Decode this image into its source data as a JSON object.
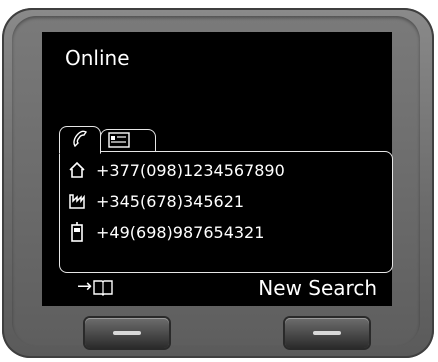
{
  "screen": {
    "title": "Online",
    "tabs": [
      {
        "icon": "phone-handset-icon",
        "selected": true
      },
      {
        "icon": "contact-card-icon",
        "selected": false
      }
    ],
    "numbers": [
      {
        "icon": "home-icon",
        "value": "+377(098)1234567890"
      },
      {
        "icon": "office-icon",
        "value": "+345(678)345621"
      },
      {
        "icon": "mobile-icon",
        "value": "+49(698)987654321"
      }
    ],
    "softkeys": {
      "left_arrow": "→",
      "left_icon": "book-icon",
      "right_label": "New Search"
    }
  },
  "colors": {
    "screen_bg": "#000000",
    "text": "#ffffff",
    "device_body": "#6c6c6c"
  }
}
